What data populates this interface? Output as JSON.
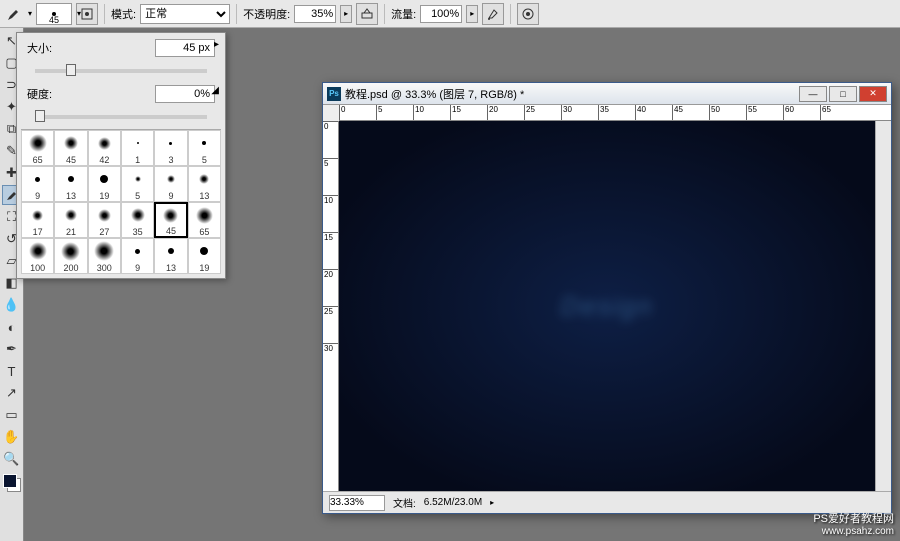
{
  "toolbar": {
    "brush_size_preview": "45",
    "mode_label": "模式:",
    "mode_value": "正常",
    "opacity_label": "不透明度:",
    "opacity_value": "35%",
    "flow_label": "流量:",
    "flow_value": "100%"
  },
  "brush_panel": {
    "size_label": "大小:",
    "size_value": "45 px",
    "hardness_label": "硬度:",
    "hardness_value": "0%",
    "size_thumb_pos": "18%",
    "hardness_thumb_pos": "0%",
    "presets": [
      {
        "size": "65",
        "type": "soft",
        "px": 18
      },
      {
        "size": "45",
        "type": "soft",
        "px": 14
      },
      {
        "size": "42",
        "type": "soft",
        "px": 13
      },
      {
        "size": "1",
        "type": "hard",
        "px": 2
      },
      {
        "size": "3",
        "type": "hard",
        "px": 3
      },
      {
        "size": "5",
        "type": "hard",
        "px": 4
      },
      {
        "size": "9",
        "type": "hard",
        "px": 5
      },
      {
        "size": "13",
        "type": "hard",
        "px": 6
      },
      {
        "size": "19",
        "type": "hard",
        "px": 8
      },
      {
        "size": "5",
        "type": "soft",
        "px": 6
      },
      {
        "size": "9",
        "type": "soft",
        "px": 8
      },
      {
        "size": "13",
        "type": "soft",
        "px": 10
      },
      {
        "size": "17",
        "type": "soft",
        "px": 11
      },
      {
        "size": "21",
        "type": "soft",
        "px": 12
      },
      {
        "size": "27",
        "type": "soft",
        "px": 13
      },
      {
        "size": "35",
        "type": "soft",
        "px": 14
      },
      {
        "size": "45",
        "type": "soft",
        "px": 15,
        "selected": true
      },
      {
        "size": "65",
        "type": "soft",
        "px": 17
      },
      {
        "size": "100",
        "type": "soft",
        "px": 18
      },
      {
        "size": "200",
        "type": "soft",
        "px": 19
      },
      {
        "size": "300",
        "type": "soft",
        "px": 20
      },
      {
        "size": "9",
        "type": "hard",
        "px": 5
      },
      {
        "size": "13",
        "type": "hard",
        "px": 6
      },
      {
        "size": "19",
        "type": "hard",
        "px": 8
      }
    ]
  },
  "document": {
    "title": "教程.psd @ 33.3% (图层 7, RGB/8) *",
    "ruler_h": [
      "0",
      "5",
      "10",
      "15",
      "20",
      "25",
      "30",
      "35",
      "40",
      "45",
      "50",
      "55",
      "60",
      "65"
    ],
    "ruler_v": [
      "0",
      "5",
      "10",
      "15",
      "20",
      "25",
      "30"
    ],
    "zoom": "33.33%",
    "doc_info_label": "文档:",
    "doc_info": "6.52M/23.0M",
    "canvas_text": "Design"
  },
  "watermark": {
    "line1": "PS爱好者教程网",
    "line2": "www.psahz.com"
  },
  "colors": {
    "foreground": "#0a1530",
    "background": "#ffffff"
  }
}
